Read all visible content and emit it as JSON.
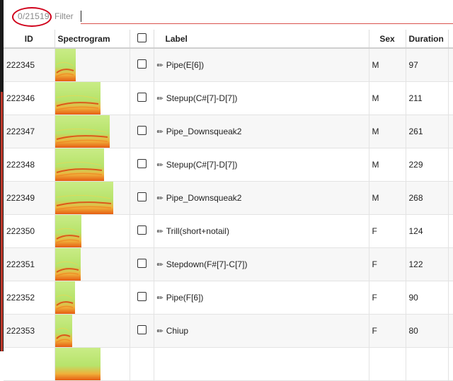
{
  "toolbar": {
    "count_text": "0/21519",
    "filter_label": "Filter",
    "filter_value": ""
  },
  "columns": {
    "id": "ID",
    "spectrogram": "Spectrogram",
    "label": "Label",
    "sex": "Sex",
    "duration": "Duration"
  },
  "rows": [
    {
      "id": "222345",
      "label": "Pipe(E[6])",
      "sex": "M",
      "duration": "97",
      "spec_width": 0.27
    },
    {
      "id": "222346",
      "label": "Stepup(C#[7]-D[7])",
      "sex": "M",
      "duration": "211",
      "spec_width": 0.6
    },
    {
      "id": "222347",
      "label": "Pipe_Downsqueak2",
      "sex": "M",
      "duration": "261",
      "spec_width": 0.73
    },
    {
      "id": "222348",
      "label": "Stepup(C#[7]-D[7])",
      "sex": "M",
      "duration": "229",
      "spec_width": 0.65
    },
    {
      "id": "222349",
      "label": "Pipe_Downsqueak2",
      "sex": "M",
      "duration": "268",
      "spec_width": 0.77
    },
    {
      "id": "222350",
      "label": "Trill(short+notail)",
      "sex": "F",
      "duration": "124",
      "spec_width": 0.35
    },
    {
      "id": "222351",
      "label": "Stepdown(F#[7]-C[7])",
      "sex": "F",
      "duration": "122",
      "spec_width": 0.34
    },
    {
      "id": "222352",
      "label": "Pipe(F[6])",
      "sex": "F",
      "duration": "90",
      "spec_width": 0.26
    },
    {
      "id": "222353",
      "label": "Chiup",
      "sex": "F",
      "duration": "80",
      "spec_width": 0.23
    },
    {
      "id": "",
      "label": "",
      "sex": "",
      "duration": "",
      "spec_width": 0.6
    }
  ],
  "colors": {
    "accent_red": "#d0021b",
    "spectrogram_base": "#b7e36b",
    "spectrogram_hot": "#e65c12"
  }
}
